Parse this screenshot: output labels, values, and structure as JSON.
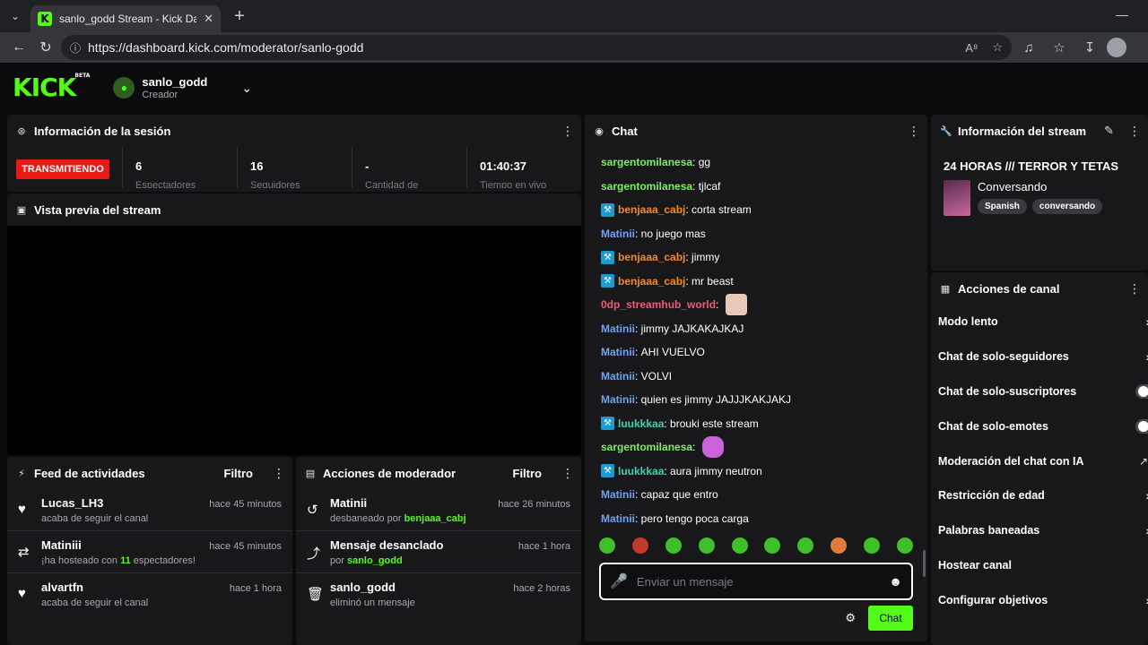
{
  "browser": {
    "tab_title": "sanlo_godd Stream - Kick Dashboard",
    "tab_favicon": "K",
    "url": "https://dashboard.kick.com/moderator/sanlo-godd"
  },
  "header": {
    "logo": "KICK",
    "beta": "BETA",
    "channel_name": "sanlo_godd",
    "role": "Creador"
  },
  "session": {
    "title": "Información de la sesión",
    "status": "TRANSMITIENDO",
    "stats": [
      {
        "value": "6",
        "label": "Espectadores"
      },
      {
        "value": "16",
        "label": "Seguidores"
      },
      {
        "value": "-",
        "label": "Cantidad de"
      },
      {
        "value": "01:40:37",
        "label": "Tiempo en vivo"
      }
    ]
  },
  "preview": {
    "title": "Vista previa del stream"
  },
  "activity_feed": {
    "title": "Feed de actividades",
    "filter": "Filtro",
    "items": [
      {
        "icon": "heart-icon",
        "name": "Lucas_LH3",
        "time": "hace 45 minutos",
        "desc": "acaba de seguir el canal"
      },
      {
        "icon": "host-icon",
        "name": "Matiniii",
        "time": "hace 45 minutos",
        "desc_pre": "¡ha hosteado con ",
        "desc_hl": "11",
        "desc_post": " espectadores!"
      },
      {
        "icon": "heart-icon",
        "name": "alvartfn",
        "time": "hace 1 hora",
        "desc": "acaba de seguir el canal"
      }
    ]
  },
  "mod_actions": {
    "title": "Acciones de moderador",
    "filter": "Filtro",
    "items": [
      {
        "name": "Matinii",
        "time": "hace 26 minutos",
        "desc_pre": "desbaneado por ",
        "desc_hl": "benjaaa_cabj"
      },
      {
        "name": "Mensaje desanclado",
        "time": "hace 1 hora",
        "desc_pre": "por ",
        "desc_hl": "sanlo_godd"
      },
      {
        "name": "sanlo_godd",
        "time": "hace 2 horas",
        "desc": "eliminó un mensaje"
      }
    ]
  },
  "chat": {
    "title": "Chat",
    "messages": [
      {
        "user": "sargentomilanesa",
        "color": "#7cf062",
        "text": "gg",
        "mod": false
      },
      {
        "user": "sargentomilanesa",
        "color": "#7cf062",
        "text": "tjlcaf",
        "mod": false
      },
      {
        "user": "benjaaa_cabj",
        "color": "#f08c2a",
        "text": "corta stream",
        "mod": true
      },
      {
        "user": "Matinii",
        "color": "#6fa3f2",
        "text": "no juego mas",
        "mod": false
      },
      {
        "user": "benjaaa_cabj",
        "color": "#f08c2a",
        "text": "jimmy",
        "mod": true
      },
      {
        "user": "benjaaa_cabj",
        "color": "#f08c2a",
        "text": "mr beast",
        "mod": true
      },
      {
        "user": "0dp_streamhub_world",
        "color": "#f05a78",
        "text": "",
        "mod": false,
        "emote": "cat"
      },
      {
        "user": "Matinii",
        "color": "#6fa3f2",
        "text": "jimmy JAJKAKAJKAJ",
        "mod": false
      },
      {
        "user": "Matinii",
        "color": "#6fa3f2",
        "text": "AHI VUELVO",
        "mod": false
      },
      {
        "user": "Matinii",
        "color": "#6fa3f2",
        "text": "VOLVI",
        "mod": false
      },
      {
        "user": "Matinii",
        "color": "#6fa3f2",
        "text": "quien es jimmy JAJJJKAKJAKJ",
        "mod": false
      },
      {
        "user": "luukkkaa",
        "color": "#3fd1b0",
        "text": "brouki este stream",
        "mod": true
      },
      {
        "user": "sargentomilanesa",
        "color": "#7cf062",
        "text": "",
        "mod": false,
        "emote": "pink"
      },
      {
        "user": "luukkkaa",
        "color": "#3fd1b0",
        "text": "aura jimmy neutron",
        "mod": true
      },
      {
        "user": "Matinii",
        "color": "#6fa3f2",
        "text": "capaz que entro",
        "mod": false
      },
      {
        "user": "Matinii",
        "color": "#6fa3f2",
        "text": "pero tengo poca carga",
        "mod": false
      }
    ],
    "placeholder": "Enviar un mensaje",
    "send_label": "Chat"
  },
  "stream_info": {
    "title": "Información del stream",
    "stream_title": "24 HORAS /// TERROR Y TETAS",
    "category": "Conversando",
    "tags": [
      "Spanish",
      "conversando"
    ]
  },
  "channel_actions": {
    "title": "Acciones de canal",
    "items": [
      {
        "label": "Modo lento",
        "control": "chevron"
      },
      {
        "label": "Chat de solo-seguidores",
        "control": "chevron"
      },
      {
        "label": "Chat de solo-suscriptores",
        "control": "toggle"
      },
      {
        "label": "Chat de solo-emotes",
        "control": "toggle"
      },
      {
        "label": "Moderación del chat con IA",
        "control": "external"
      },
      {
        "label": "Restricción de edad",
        "control": "chevron"
      },
      {
        "label": "Palabras baneadas",
        "control": "chevron"
      },
      {
        "label": "Hostear canal",
        "control": "none"
      },
      {
        "label": "Configurar objetivos",
        "control": "chevron"
      }
    ]
  },
  "colors": {
    "accent": "#53fc18",
    "live": "#e91916",
    "panel": "#18181b"
  }
}
